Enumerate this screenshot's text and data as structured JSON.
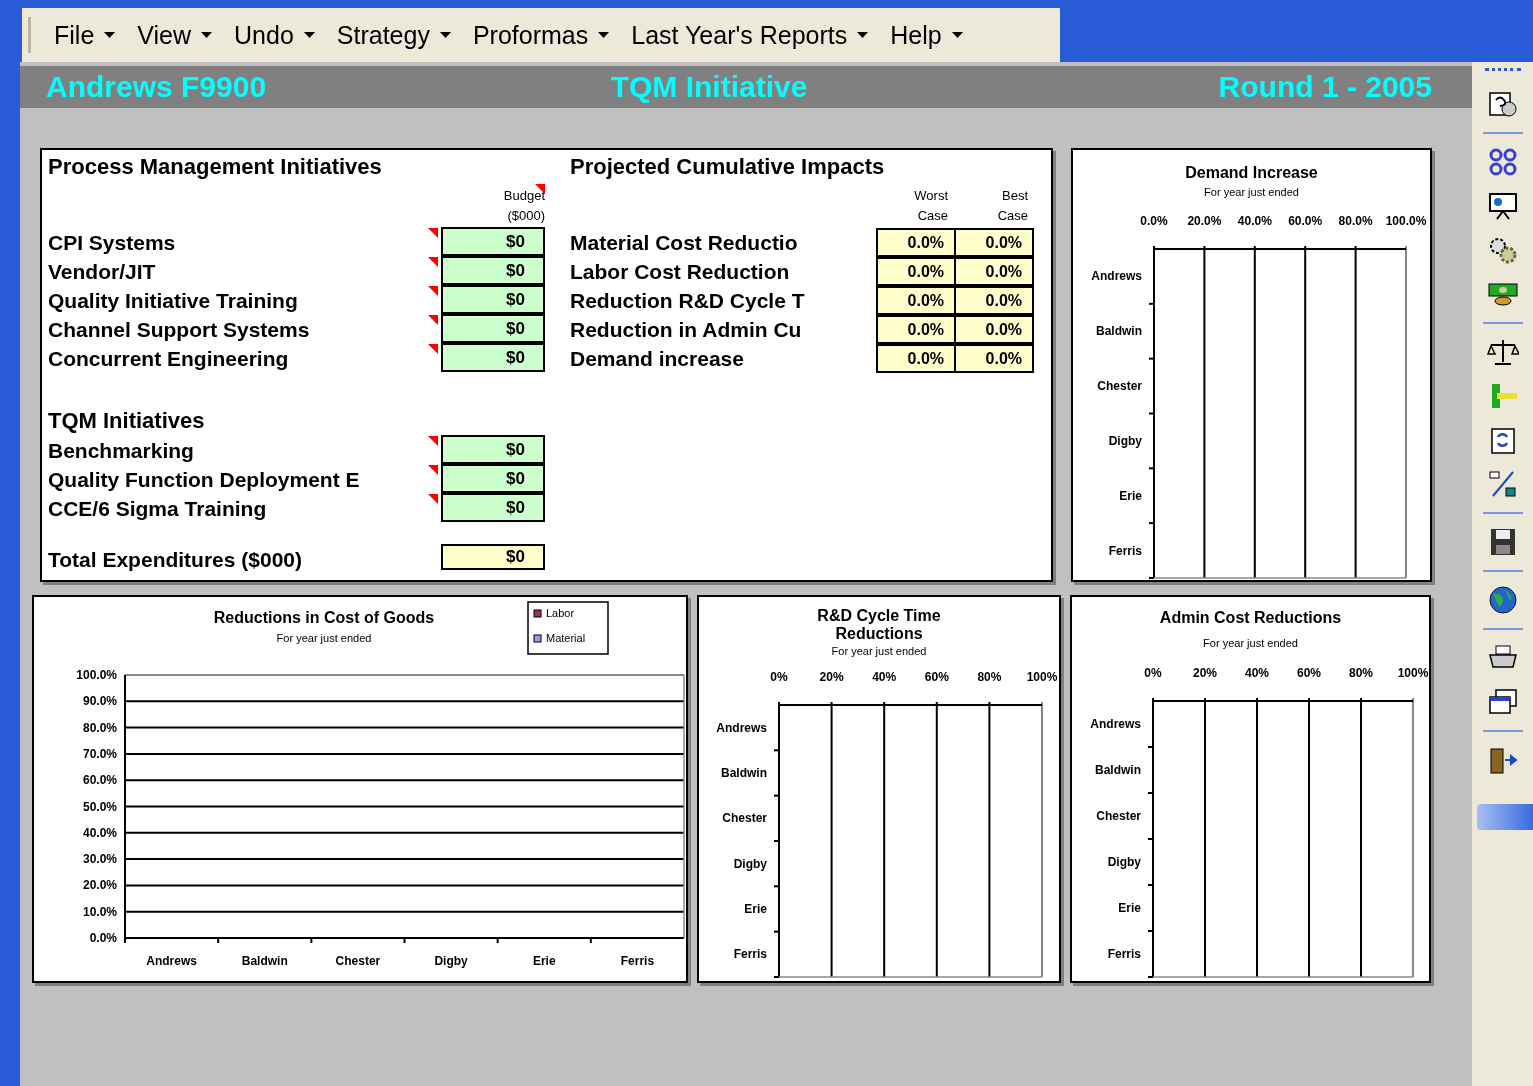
{
  "menu": [
    {
      "label": "File"
    },
    {
      "label": "View"
    },
    {
      "label": "Undo"
    },
    {
      "label": "Strategy"
    },
    {
      "label": "Proformas"
    },
    {
      "label": "Last Year's Reports"
    },
    {
      "label": "Help"
    }
  ],
  "header": {
    "team": "Andrews F9900",
    "title": "TQM Initiative",
    "round": "Round 1 - 2005"
  },
  "process": {
    "title": "Process Management Initiatives",
    "budget_header": "Budget",
    "budget_unit": "($000)",
    "budget_comment": true,
    "items": [
      {
        "label": "CPI Systems",
        "value": "$0",
        "comment": true
      },
      {
        "label": "Vendor/JIT",
        "value": "$0",
        "comment": true
      },
      {
        "label": "Quality Initiative Training",
        "value": "$0",
        "comment": true
      },
      {
        "label": "Channel Support Systems",
        "value": "$0",
        "comment": true
      },
      {
        "label": "Concurrent Engineering",
        "value": "$0",
        "comment": true
      }
    ]
  },
  "tqm": {
    "title": "TQM Initiatives",
    "items": [
      {
        "label": "Benchmarking",
        "value": "$0",
        "comment": true
      },
      {
        "label": "Quality Function Deployment E",
        "value": "$0",
        "comment": true
      },
      {
        "label": "CCE/6 Sigma Training",
        "value": "$0",
        "comment": true
      }
    ]
  },
  "total": {
    "label": "Total Expenditures ($000)",
    "value": "$0"
  },
  "impacts": {
    "title": "Projected Cumulative Impacts",
    "columns": [
      {
        "line1": "Worst",
        "line2": "Case"
      },
      {
        "line1": "Best",
        "line2": "Case"
      }
    ],
    "rows": [
      {
        "label": "Material Cost Reductio",
        "worst": "0.0%",
        "best": "0.0%"
      },
      {
        "label": "Labor Cost Reduction",
        "worst": "0.0%",
        "best": "0.0%"
      },
      {
        "label": "Reduction R&D Cycle T",
        "worst": "0.0%",
        "best": "0.0%"
      },
      {
        "label": "Reduction in Admin Cu",
        "worst": "0.0%",
        "best": "0.0%"
      },
      {
        "label": "Demand increase",
        "worst": "0.0%",
        "best": "0.0%"
      }
    ]
  },
  "demand_chart": {
    "subtitle": "For year just ended",
    "chart_data": {
      "type": "bar",
      "orientation": "horizontal",
      "grid": true,
      "title": "Demand Increase",
      "categories": [
        "Andrews",
        "Baldwin",
        "Chester",
        "Digby",
        "Erie",
        "Ferris"
      ],
      "values": [
        0,
        0,
        0,
        0,
        0,
        0
      ],
      "xlim": [
        0,
        100
      ],
      "xticks": [
        {
          "value": 0,
          "label": "0.0%"
        },
        {
          "value": 20,
          "label": "20.0%"
        },
        {
          "value": 40,
          "label": "40.0%"
        },
        {
          "value": 60,
          "label": "60.0%"
        },
        {
          "value": 80,
          "label": "80.0%"
        },
        {
          "value": 100,
          "label": "100.0%"
        }
      ]
    }
  },
  "cogs_chart": {
    "subtitle": "For year just ended",
    "chart_data": {
      "type": "bar",
      "grid": true,
      "title": "Reductions in Cost of Goods",
      "categories": [
        "Andrews",
        "Baldwin",
        "Chester",
        "Digby",
        "Erie",
        "Ferris"
      ],
      "series": [
        {
          "name": "Labor",
          "color": "#993366",
          "values": [
            0,
            0,
            0,
            0,
            0,
            0
          ]
        },
        {
          "name": "Material",
          "color": "#9999ff",
          "values": [
            0,
            0,
            0,
            0,
            0,
            0
          ]
        }
      ],
      "ylim": [
        0,
        100
      ],
      "yticks": [
        {
          "value": 0,
          "label": "0.0%"
        },
        {
          "value": 10,
          "label": "10.0%"
        },
        {
          "value": 20,
          "label": "20.0%"
        },
        {
          "value": 30,
          "label": "30.0%"
        },
        {
          "value": 40,
          "label": "40.0%"
        },
        {
          "value": 50,
          "label": "50.0%"
        },
        {
          "value": 60,
          "label": "60.0%"
        },
        {
          "value": 70,
          "label": "70.0%"
        },
        {
          "value": 80,
          "label": "80.0%"
        },
        {
          "value": 90,
          "label": "90.0%"
        },
        {
          "value": 100,
          "label": "100.0%"
        }
      ]
    }
  },
  "rd_chart": {
    "subtitle": "For year just ended",
    "chart_data": {
      "type": "bar",
      "orientation": "horizontal",
      "grid": true,
      "title": "R&D Cycle Time Reductions",
      "categories": [
        "Andrews",
        "Baldwin",
        "Chester",
        "Digby",
        "Erie",
        "Ferris"
      ],
      "values": [
        0,
        0,
        0,
        0,
        0,
        0
      ],
      "xlim": [
        0,
        100
      ],
      "xticks": [
        {
          "value": 0,
          "label": "0%"
        },
        {
          "value": 20,
          "label": "20%"
        },
        {
          "value": 40,
          "label": "40%"
        },
        {
          "value": 60,
          "label": "60%"
        },
        {
          "value": 80,
          "label": "80%"
        },
        {
          "value": 100,
          "label": "100%"
        }
      ]
    }
  },
  "admin_chart": {
    "subtitle": "For year just ended",
    "chart_data": {
      "type": "bar",
      "orientation": "horizontal",
      "grid": true,
      "title": "Admin Cost Reductions",
      "categories": [
        "Andrews",
        "Baldwin",
        "Chester",
        "Digby",
        "Erie",
        "Ferris"
      ],
      "values": [
        0,
        0,
        0,
        0,
        0,
        0
      ],
      "xlim": [
        0,
        100
      ],
      "xticks": [
        {
          "value": 0,
          "label": "0%"
        },
        {
          "value": 20,
          "label": "20%"
        },
        {
          "value": 40,
          "label": "40%"
        },
        {
          "value": 60,
          "label": "60%"
        },
        {
          "value": 80,
          "label": "80%"
        },
        {
          "value": 100,
          "label": "100%"
        }
      ]
    }
  }
}
